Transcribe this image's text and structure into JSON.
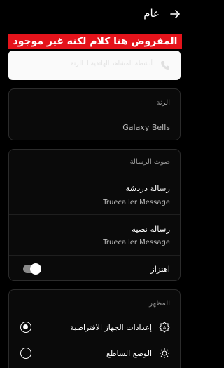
{
  "header": {
    "title": "عام",
    "back_icon": "arrow-right-icon"
  },
  "annotation_banner": {
    "text": "المفروض هنا كلام لكنه غير موجود",
    "color": "#e5131b"
  },
  "phone_account_card": {
    "icon": "phone-icon",
    "text": "أنشطة المشاهد الهاتفية لـ الرنة"
  },
  "ringtone": {
    "title": "الرنة",
    "value": "Galaxy Bells"
  },
  "message_sound": {
    "title": "صوت الرسالة",
    "chat": {
      "label": "رسالة دردشة",
      "value": "Truecaller Message"
    },
    "sms": {
      "label": "رسالة نصية",
      "value": "Truecaller Message"
    },
    "vibration": {
      "label": "اهتزاز",
      "enabled": true
    }
  },
  "appearance": {
    "title": "المظهر",
    "options": [
      {
        "label": "إعدادات الجهاز الافتراضية",
        "icon": "auto-brightness-icon",
        "selected": true
      },
      {
        "label": "الوضع الساطع",
        "icon": "sun-icon",
        "selected": false
      }
    ]
  }
}
